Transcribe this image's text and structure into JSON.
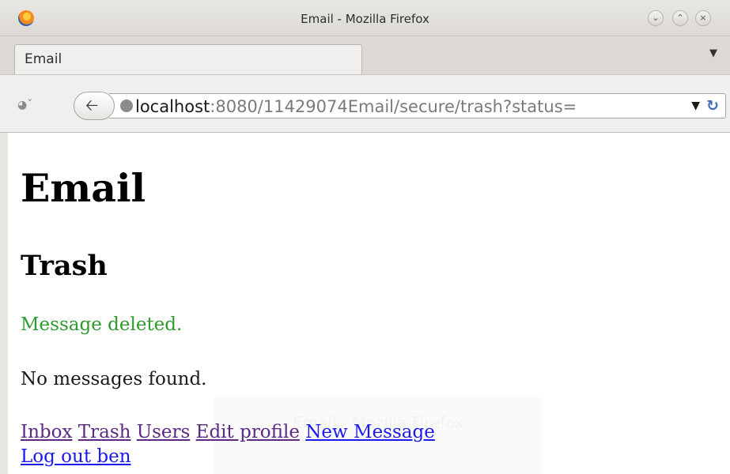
{
  "window": {
    "title": "Email - Mozilla Firefox"
  },
  "tabs": [
    {
      "label": "Email"
    }
  ],
  "address_bar": {
    "host": "localhost",
    "rest": ":8080/11429074Email/secure/trash?status="
  },
  "page": {
    "title": "Email",
    "section": "Trash",
    "status_message": "Message deleted.",
    "empty_message": "No messages found.",
    "links": [
      {
        "label": "Inbox",
        "visited": true
      },
      {
        "label": "Trash",
        "visited": true
      },
      {
        "label": "Users",
        "visited": true
      },
      {
        "label": "Edit profile",
        "visited": true
      },
      {
        "label": "New Message",
        "visited": false
      },
      {
        "label": "Log out ben",
        "visited": false
      }
    ]
  },
  "overlay": {
    "text": "Email - Mozilla Firefox"
  },
  "colors": {
    "status_green": "#2e9a2e",
    "link_visited": "#5b2a82",
    "link_new": "#1a1aee"
  },
  "icons": [
    "firefox-logo-icon",
    "minimize-icon",
    "maximize-icon",
    "close-icon",
    "tab-list-arrow-icon",
    "history-icon",
    "back-arrow-icon",
    "globe-icon",
    "url-dropdown-icon",
    "reload-icon"
  ]
}
